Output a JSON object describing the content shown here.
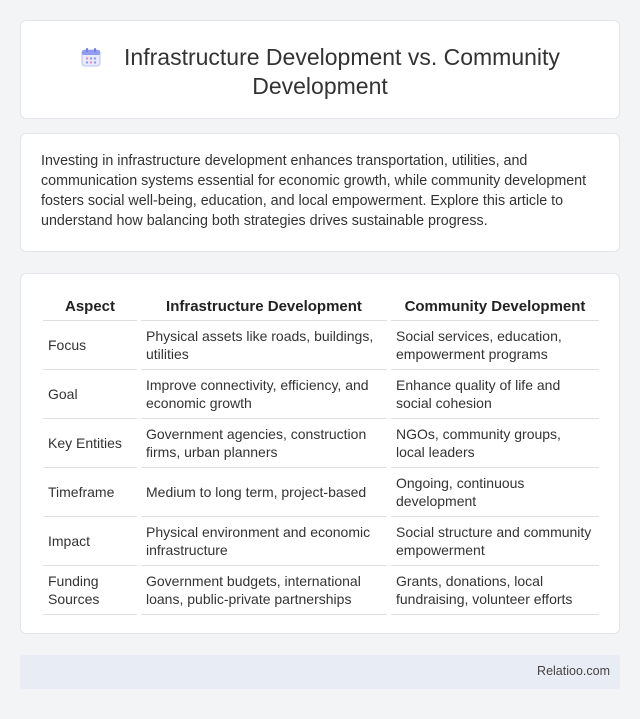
{
  "header": {
    "title": "Infrastructure Development vs. Community Development",
    "icon": "calendar-icon"
  },
  "intro": {
    "text": "Investing in infrastructure development enhances transportation, utilities, and communication systems essential for economic growth, while community development fosters social well-being, education, and local empowerment. Explore this article to understand how balancing both strategies drives sustainable progress."
  },
  "table": {
    "headers": [
      "Aspect",
      "Infrastructure Development",
      "Community Development"
    ],
    "rows": [
      [
        "Focus",
        "Physical assets like roads, buildings, utilities",
        "Social services, education, empowerment programs"
      ],
      [
        "Goal",
        "Improve connectivity, efficiency, and economic growth",
        "Enhance quality of life and social cohesion"
      ],
      [
        "Key Entities",
        "Government agencies, construction firms, urban planners",
        "NGOs, community groups, local leaders"
      ],
      [
        "Timeframe",
        "Medium to long term, project-based",
        "Ongoing, continuous development"
      ],
      [
        "Impact",
        "Physical environment and economic infrastructure",
        "Social structure and community empowerment"
      ],
      [
        "Funding Sources",
        "Government budgets, international loans, public-private partnerships",
        "Grants, donations, local fundraising, volunteer efforts"
      ]
    ]
  },
  "footer": {
    "brand": "Relatioo.com"
  },
  "colors": {
    "background": "#f3f4f6",
    "card": "#ffffff",
    "footer": "#e8ecf5",
    "icon_accent": "#7b8cf0"
  }
}
